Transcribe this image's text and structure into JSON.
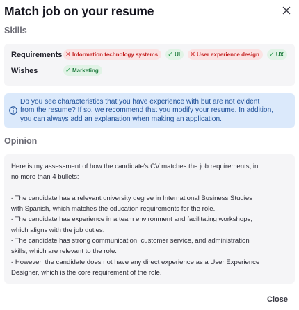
{
  "dialog": {
    "title": "Match job on your resume",
    "close_icon": "close-icon"
  },
  "skills": {
    "section_label": "Skills",
    "requirements_label": "Requirements",
    "requirements": [
      {
        "label": "Information technology systems",
        "status": "missing",
        "icon": "x-icon"
      },
      {
        "label": "UI",
        "status": "matched",
        "icon": "check-icon"
      },
      {
        "label": "User experience design",
        "status": "missing",
        "icon": "x-icon"
      },
      {
        "label": "UX",
        "status": "matched",
        "icon": "check-icon"
      }
    ],
    "wishes_label": "Wishes",
    "wishes": [
      {
        "label": "Marketing",
        "status": "matched",
        "icon": "check-icon"
      }
    ]
  },
  "info": {
    "icon": "info-icon",
    "lines": [
      "Do you see characteristics that you have experience with but are not evident",
      "from the resume? If so, we recommend that you modify your resume. In addition,",
      "you can always add an explanation when making an application."
    ]
  },
  "opinion": {
    "section_label": "Opinion",
    "lines": [
      "Here is my assessment of how the candidate's CV matches the job requirements, in",
      "no more than 4 bullets:",
      "",
      "- The candidate has a relevant university degree in International Business Studies",
      "with Spanish, which matches the education requirements for the role.",
      "- The candidate has experience in a team environment and facilitating workshops,",
      "which aligns with the job duties.",
      "- The candidate has strong communication, customer service, and administration",
      "skills, which are relevant to the role.",
      "- However, the candidate does not have any direct experience as a User Experience",
      "Designer, which is the core requirement of the role."
    ]
  },
  "footer": {
    "close_label": "Close"
  },
  "colors": {
    "missing_bg": "#fbe2e2",
    "missing_fg": "#c42323",
    "matched_bg": "#e1f3e6",
    "matched_fg": "#1d7a3c",
    "info_bg": "#dbe9fb",
    "info_fg": "#1e4f98"
  }
}
